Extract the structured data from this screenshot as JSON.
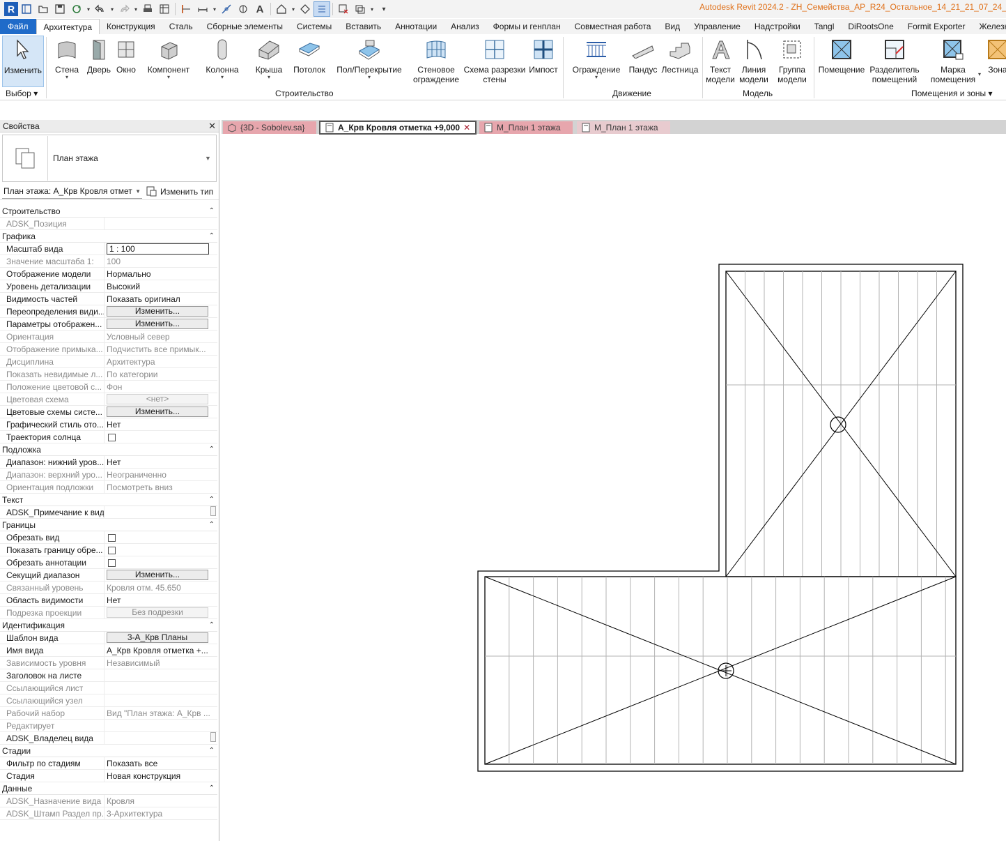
{
  "app": {
    "title": "Autodesk Revit 2024.2 - ZH_Семейства_АР_R24_Остальное_14_21_21_07_24_Sob",
    "logo_letter": "R"
  },
  "menu_tabs": [
    "Файл",
    "Архитектура",
    "Конструкция",
    "Сталь",
    "Сборные элементы",
    "Системы",
    "Вставить",
    "Аннотации",
    "Анализ",
    "Формы и генплан",
    "Совместная работа",
    "Вид",
    "Управление",
    "Надстройки",
    "Tangl",
    "DiRootsOne",
    "Formit Exporter",
    "Железно"
  ],
  "ribbon": {
    "modify": "Изменить",
    "wall": "Стена",
    "door": "Дверь",
    "window": "Окно",
    "component": "Компонент",
    "column": "Колонна",
    "roof": "Крыша",
    "ceiling": "Потолок",
    "floor": "Пол/Перекрытие",
    "curtain_system_1": "Стеновое",
    "curtain_system_2": "ограждение",
    "curtain_grid_1": "Схема разрезки",
    "curtain_grid_2": "стены",
    "mullion": "Импост",
    "railing": "Ограждение",
    "ramp": "Пандус",
    "stair": "Лестница",
    "model_text_1": "Текст",
    "model_text_2": "модели",
    "model_line_1": "Линия",
    "model_line_2": "модели",
    "model_group_1": "Группа",
    "model_group_2": "модели",
    "room": "Помещение",
    "room_separator_1": "Разделитель",
    "room_separator_2": "помещений",
    "room_tag_1": "Марка",
    "room_tag_2": "помещения",
    "area": "Зона",
    "panel_select": "Выбор",
    "panel_build": "Строительство",
    "panel_circulation": "Движение",
    "panel_model": "Модель",
    "panel_rooms": "Помещения и зоны"
  },
  "properties": {
    "title": "Свойства",
    "type_name": "План этажа",
    "instance": "План этажа: А_Крв Кровля отмет",
    "edit_type": "Изменить тип",
    "groups": [
      {
        "name": "Строительство",
        "rows": [
          {
            "n": "ADSK_Позиция",
            "v": "",
            "ro": true
          }
        ]
      },
      {
        "name": "Графика",
        "rows": [
          {
            "n": "Масштаб вида",
            "v": "1 : 100",
            "kind": "input"
          },
          {
            "n": "Значение масштаба    1:",
            "v": "100",
            "ro": true
          },
          {
            "n": "Отображение модели",
            "v": "Нормально"
          },
          {
            "n": "Уровень детализации",
            "v": "Высокий"
          },
          {
            "n": "Видимость частей",
            "v": "Показать оригинал"
          },
          {
            "n": "Переопределения види...",
            "v": "Изменить...",
            "kind": "button"
          },
          {
            "n": "Параметры отображен...",
            "v": "Изменить...",
            "kind": "button"
          },
          {
            "n": "Ориентация",
            "v": "Условный север",
            "ro": true
          },
          {
            "n": "Отображение примыка...",
            "v": "Подчистить все примык...",
            "ro": true
          },
          {
            "n": "Дисциплина",
            "v": "Архитектура",
            "ro": true
          },
          {
            "n": "Показать невидимые л...",
            "v": "По категории",
            "ro": true
          },
          {
            "n": "Положение цветовой с...",
            "v": "Фон",
            "ro": true
          },
          {
            "n": "Цветовая схема",
            "v": "<нет>",
            "kind": "button",
            "ro": true
          },
          {
            "n": "Цветовые схемы систе...",
            "v": "Изменить...",
            "kind": "button"
          },
          {
            "n": "Графический стиль ото...",
            "v": "Нет"
          },
          {
            "n": "Траектория солнца",
            "v": "",
            "kind": "check"
          }
        ]
      },
      {
        "name": "Подложка",
        "rows": [
          {
            "n": "Диапазон: нижний уров...",
            "v": "Нет"
          },
          {
            "n": "Диапазон: верхний уро...",
            "v": "Неограниченно",
            "ro": true
          },
          {
            "n": "Ориентация подложки",
            "v": "Посмотреть вниз",
            "ro": true
          }
        ]
      },
      {
        "name": "Текст",
        "rows": [
          {
            "n": "ADSK_Примечание к виду",
            "v": "",
            "kind": "stub"
          }
        ]
      },
      {
        "name": "Границы",
        "rows": [
          {
            "n": "Обрезать вид",
            "v": "",
            "kind": "check"
          },
          {
            "n": "Показать границу обре...",
            "v": "",
            "kind": "check"
          },
          {
            "n": "Обрезать аннотации",
            "v": "",
            "kind": "check"
          },
          {
            "n": "Секущий диапазон",
            "v": "Изменить...",
            "kind": "button"
          },
          {
            "n": "Связанный уровень",
            "v": "Кровля отм. 45.650",
            "ro": true
          },
          {
            "n": "Область видимости",
            "v": "Нет"
          },
          {
            "n": "Подрезка проекции",
            "v": "Без подрезки",
            "kind": "button",
            "ro": true
          }
        ]
      },
      {
        "name": "Идентификация",
        "rows": [
          {
            "n": "Шаблон вида",
            "v": "3-А_Крв Планы",
            "kind": "button"
          },
          {
            "n": "Имя вида",
            "v": "А_Крв Кровля отметка +..."
          },
          {
            "n": "Зависимость уровня",
            "v": "Независимый",
            "ro": true
          },
          {
            "n": "Заголовок на листе",
            "v": ""
          },
          {
            "n": "Ссылающийся лист",
            "v": "",
            "ro": true
          },
          {
            "n": "Ссылающийся узел",
            "v": "",
            "ro": true
          },
          {
            "n": "Рабочий набор",
            "v": "Вид \"План этажа: А_Крв ...",
            "ro": true
          },
          {
            "n": "Редактирует",
            "v": "",
            "ro": true
          },
          {
            "n": "ADSK_Владелец вида",
            "v": "",
            "kind": "stub"
          }
        ]
      },
      {
        "name": "Стадии",
        "rows": [
          {
            "n": "Фильтр по стадиям",
            "v": "Показать все"
          },
          {
            "n": "Стадия",
            "v": "Новая конструкция"
          }
        ]
      },
      {
        "name": "Данные",
        "rows": [
          {
            "n": "ADSK_Назначение вида",
            "v": "Кровля",
            "ro": true
          },
          {
            "n": "ADSK_Штамп Раздел пр...",
            "v": "3-Архитектура",
            "ro": true
          }
        ]
      }
    ]
  },
  "view_tabs": [
    {
      "label": "{3D - Sobolev.sa}"
    },
    {
      "label": "А_Крв Кровля отметка +9,000",
      "close": "✕"
    },
    {
      "label": "М_План 1 этажа"
    },
    {
      "label": "М_План 1 этажа"
    }
  ],
  "colors": {
    "accent": "#1f6bc9",
    "title": "#e0711a",
    "tab_pink": "#e7a6ad"
  }
}
